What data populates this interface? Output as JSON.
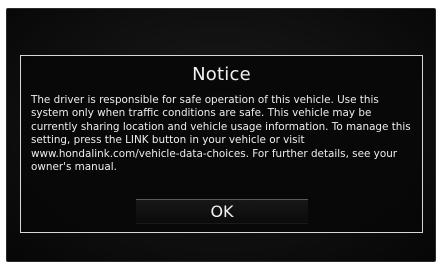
{
  "dialog": {
    "title": "Notice",
    "message": "The driver is responsible for safe operation of this vehicle. Use this system only when traffic conditions are safe. This vehicle may be currently sharing location and vehicle usage information. To manage this setting, press the LINK button in your vehicle or visit www.hondalink.com/vehicle-data-choices. For further details, see your owner's manual.",
    "ok_label": "OK"
  }
}
